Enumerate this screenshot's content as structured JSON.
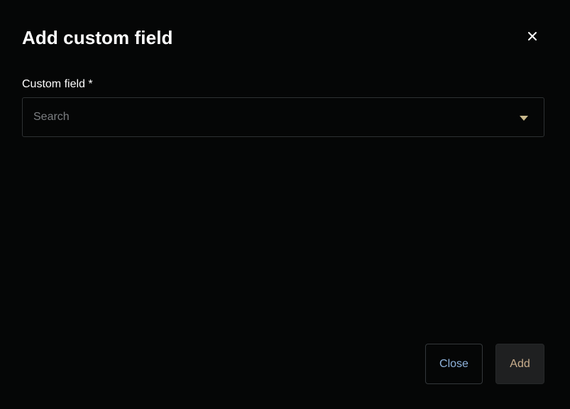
{
  "dialog": {
    "title": "Add custom field",
    "close_icon": "close-icon"
  },
  "form": {
    "custom_field_label": "Custom field *",
    "search_placeholder": "Search",
    "search_value": "",
    "dropdown_icon": "caret-down-icon"
  },
  "footer": {
    "close_label": "Close",
    "add_label": "Add"
  },
  "colors": {
    "background": "#050606",
    "title_text": "#ffffff",
    "input_border": "#2e3133",
    "placeholder": "#7c7f82",
    "caret": "#c9b98c",
    "close_button_text": "#8fb3dc",
    "add_button_bg": "#1f2021",
    "add_button_text": "#c9ae8c"
  }
}
